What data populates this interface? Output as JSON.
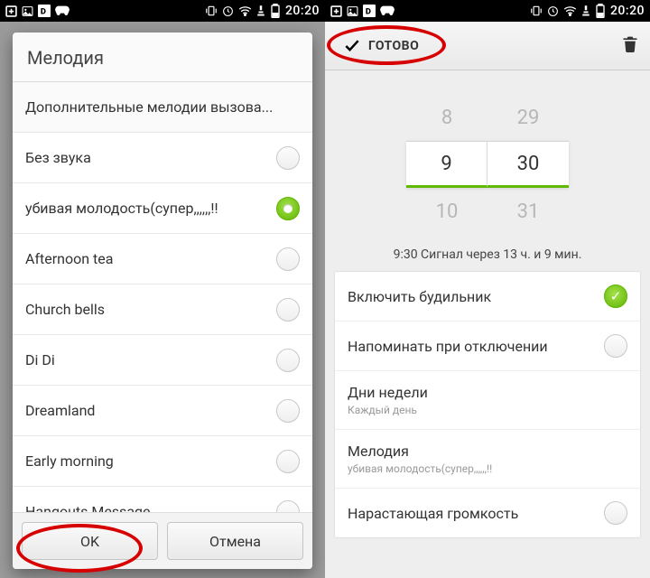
{
  "status": {
    "time": "20:20"
  },
  "left": {
    "dialog_title": "Мелодия",
    "items": [
      {
        "label": "Дополнительные мелодии вызова...",
        "radio": false
      },
      {
        "label": "Без звука",
        "radio": true,
        "selected": false
      },
      {
        "label": "убивая молодость(супер,,,,,,!!",
        "radio": true,
        "selected": true
      },
      {
        "label": "Afternoon tea",
        "radio": true,
        "selected": false
      },
      {
        "label": "Church bells",
        "radio": true,
        "selected": false
      },
      {
        "label": "Di Di",
        "radio": true,
        "selected": false
      },
      {
        "label": "Dreamland",
        "radio": true,
        "selected": false
      },
      {
        "label": "Early morning",
        "radio": true,
        "selected": false
      },
      {
        "label": "Hangouts Message",
        "radio": true,
        "selected": false
      }
    ],
    "ok": "OK",
    "cancel": "Отмена"
  },
  "right": {
    "done": "ГОТОВО",
    "picker": {
      "h_prev": "8",
      "h": "9",
      "h_next": "10",
      "m_prev": "29",
      "m": "30",
      "m_next": "31"
    },
    "subtitle": "9:30 Сигнал через 13 ч. и 9 мин.",
    "rows": [
      {
        "label": "Включить будильник",
        "toggle": true,
        "on": true
      },
      {
        "label": "Напоминать при отключении",
        "toggle": true,
        "on": false
      },
      {
        "label": "Дни недели",
        "sub": "Каждый день"
      },
      {
        "label": "Мелодия",
        "sub": "убивая молодость(супер,,,,,,!!"
      },
      {
        "label": "Нарастающая громкость",
        "toggle": true,
        "on": false
      }
    ]
  }
}
